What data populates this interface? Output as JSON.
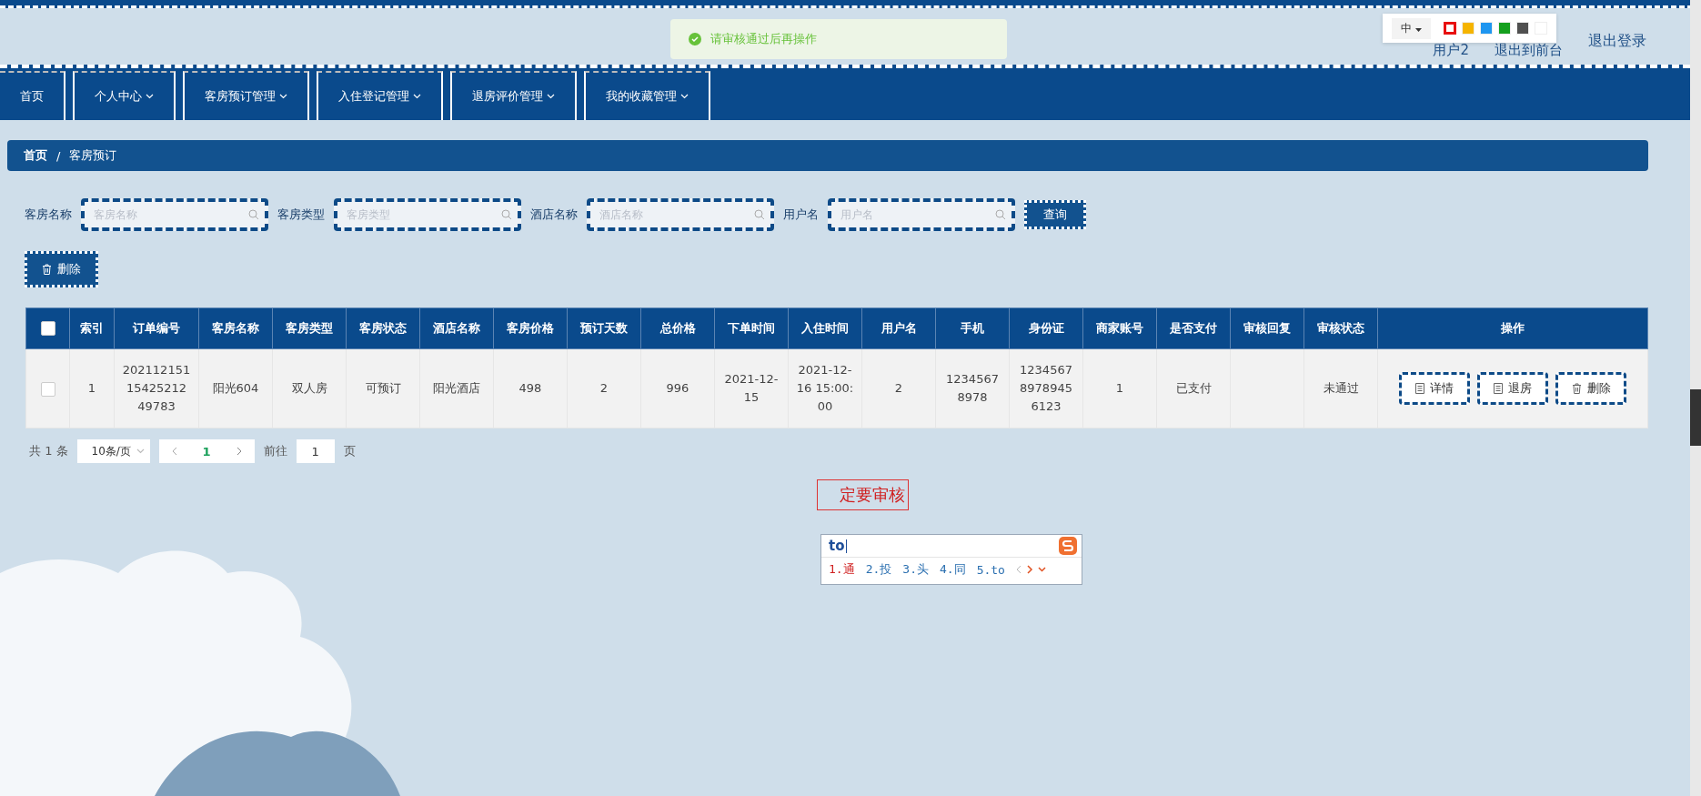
{
  "top_bar": {
    "user": "用户2",
    "front": "退出到前台",
    "logout": "退出登录"
  },
  "toast": {
    "message": "请审核通过后再操作"
  },
  "color_picker": {
    "language": "中",
    "swatches": [
      {
        "color": "#e81010",
        "selected": true
      },
      {
        "color": "#f5b400",
        "selected": false
      },
      {
        "color": "#1e96f0",
        "selected": false
      },
      {
        "color": "#14a01e",
        "selected": false
      },
      {
        "color": "#505050",
        "selected": false
      },
      {
        "color": "#ffffff",
        "selected": false
      }
    ]
  },
  "nav": [
    {
      "label": "首页",
      "dropdown": false
    },
    {
      "label": "个人中心",
      "dropdown": true
    },
    {
      "label": "客房预订管理",
      "dropdown": true
    },
    {
      "label": "入住登记管理",
      "dropdown": true
    },
    {
      "label": "退房评价管理",
      "dropdown": true
    },
    {
      "label": "我的收藏管理",
      "dropdown": true
    }
  ],
  "breadcrumb": {
    "items": [
      "首页",
      "客房预订"
    ],
    "separator": "/"
  },
  "search": {
    "fields": [
      {
        "label": "客房名称",
        "placeholder": "客房名称"
      },
      {
        "label": "客房类型",
        "placeholder": "客房类型"
      },
      {
        "label": "酒店名称",
        "placeholder": "酒店名称"
      },
      {
        "label": "用户名",
        "placeholder": "用户名"
      }
    ],
    "button": "查询"
  },
  "delete_button": "删除",
  "table": {
    "select_all_checked": false,
    "columns": [
      "索引",
      "订单编号",
      "客房名称",
      "客房类型",
      "客房状态",
      "酒店名称",
      "客房价格",
      "预订天数",
      "总价格",
      "下单时间",
      "入住时间",
      "用户名",
      "手机",
      "身份证",
      "商家账号",
      "是否支付",
      "审核回复",
      "审核状态",
      "操作"
    ],
    "rows": [
      {
        "selected": false,
        "cells": [
          "1",
          "20211215115425212 49783",
          "阳光604",
          "双人房",
          "可预订",
          "阳光酒店",
          "498",
          "2",
          "996",
          "2021-12-15",
          "2021-12-16 15:00:00",
          "2",
          "12345678978",
          "123456789789456123",
          "1",
          "已支付",
          "",
          "未通过"
        ],
        "actions": [
          {
            "label": "详情",
            "kind": "document"
          },
          {
            "label": "退房",
            "kind": "document"
          },
          {
            "label": "删除",
            "kind": "trash"
          }
        ]
      }
    ]
  },
  "pagination": {
    "total": "共 1 条",
    "page_size": "10条/页",
    "current": "1",
    "goto_label": "前往",
    "goto_value": "1",
    "goto_unit": "页"
  },
  "overlay_text": "定要审核",
  "ime": {
    "input": "to",
    "candidates": [
      {
        "label": "1.通",
        "selected": true
      },
      {
        "label": "2.投",
        "selected": false
      },
      {
        "label": "3.头",
        "selected": false
      },
      {
        "label": "4.同",
        "selected": false
      },
      {
        "label": "5.to",
        "selected": false
      }
    ]
  }
}
